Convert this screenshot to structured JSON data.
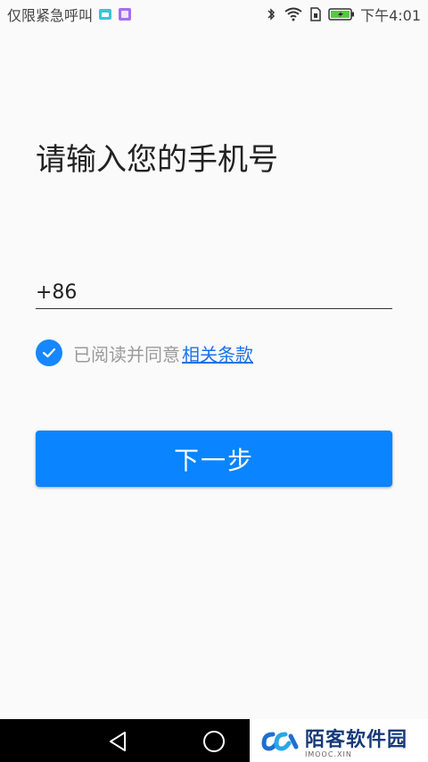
{
  "status_bar": {
    "carrier": "仅限紧急呼叫",
    "time": "下午4:01",
    "icons": [
      "android-icon",
      "image-icon",
      "bluetooth-icon",
      "wifi-icon",
      "sim-icon",
      "battery-charging-icon"
    ]
  },
  "title": "请输入您的手机号",
  "phone": {
    "prefix": "+86",
    "value": "",
    "placeholder": ""
  },
  "agreement": {
    "checked": true,
    "text": "已阅读并同意",
    "link": "相关条款"
  },
  "next_button": "下一步",
  "navigation": {
    "icons": [
      "back-icon",
      "home-icon"
    ]
  },
  "watermark": {
    "name": "陌客软件园",
    "sub": "IMOOC.XIN"
  },
  "colors": {
    "accent": "#0a84ff",
    "link": "#1a73e8",
    "background": "#fafafa"
  }
}
